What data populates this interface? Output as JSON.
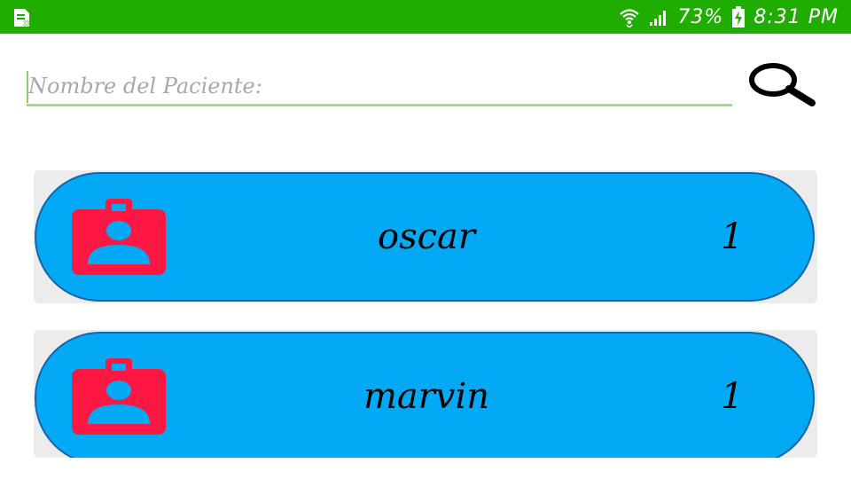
{
  "status_bar": {
    "battery": "73%",
    "time": "8:31 PM",
    "notification_icon": "sim-card-icon",
    "wifi_icon": "wifi-icon",
    "signal_icon": "signal-icon",
    "battery_icon": "battery-charging-icon",
    "background_color": "#1fae00"
  },
  "search": {
    "placeholder": "Nombre del Paciente:",
    "value": "",
    "button_icon": "search-icon",
    "underline_color": "#9de27a"
  },
  "patients": [
    {
      "name": "oscar",
      "count": "1",
      "icon": "contact-badge-icon"
    },
    {
      "name": "marvin",
      "count": "1",
      "icon": "contact-badge-icon"
    }
  ],
  "colors": {
    "card": "#03a9f4",
    "card_border": "#1565a8",
    "badge": "#ff1744"
  }
}
